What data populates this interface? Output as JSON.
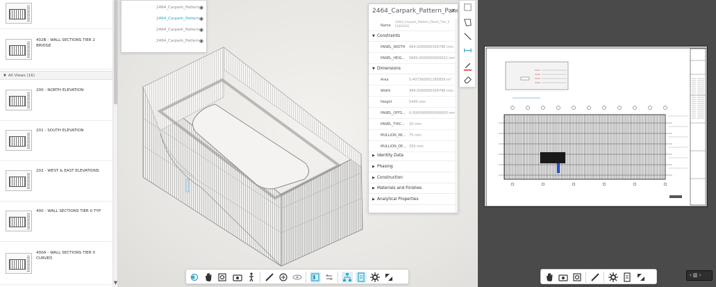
{
  "sheets_panel": {
    "section_header": "All Views (16)",
    "items_top": [
      {
        "label": ""
      },
      {
        "label": "402B - WALL SECTIONS TIER 2 BRIDGE"
      }
    ],
    "items": [
      {
        "label": "200 - NORTH ELEVATION"
      },
      {
        "label": "201 - SOUTH ELEVATION"
      },
      {
        "label": "202 - WEST & EAST ELEVATIONS"
      },
      {
        "label": "400 - WALL SECTIONS TIER 0 TYP"
      },
      {
        "label": "400A - WALL SECTIONS TIER 0 CURVED"
      }
    ]
  },
  "model_browser": {
    "rows": [
      {
        "label": "2464_Carpark_Pattern",
        "active": false
      },
      {
        "label": "2464_Carpark_Pattern",
        "active": true
      },
      {
        "label": "2464_Carpark_Pattern",
        "active": false
      },
      {
        "label": "2464_Carpark_Pattern",
        "active": false
      }
    ]
  },
  "properties": {
    "title": "2464_Carpark_Pattern_Panel",
    "name_key": "Name",
    "name_value": "2464_Carpark_Pattern_Panel_Tier_1 [349102]",
    "sections": {
      "constraints": "Constraints",
      "dimensions": "Dimensions",
      "identity": "Identity Data",
      "phasing": "Phasing",
      "construction": "Construction",
      "materials": "Materials and Finishes",
      "analytical": "Analytical Properties"
    },
    "constraints_rows": [
      {
        "k": "PANEL_WIDTH",
        "v": "994.0000000304796 mm"
      },
      {
        "k": "PANEL_HEIG...",
        "v": "5680.0000000000022 mm"
      }
    ],
    "dimension_rows": [
      {
        "k": "Area",
        "v": "5.407360001165859 m²"
      },
      {
        "k": "Width",
        "v": "994.0000000304796 mm"
      },
      {
        "k": "Height",
        "v": "5440 mm"
      },
      {
        "k": "PANEL_OFFS...",
        "v": "0.0000000000000000 mm"
      },
      {
        "k": "PANEL_THIC...",
        "v": "10 mm"
      },
      {
        "k": "MULLION_WI...",
        "v": "75 mm"
      },
      {
        "k": "MULLION_DE...",
        "v": "250 mm"
      }
    ]
  },
  "sheet_viewer": {
    "pager_label": "‹ ▥ ›"
  },
  "colors": {
    "accent": "#2aa3c9",
    "viewer_bg": "#4a4a4a"
  }
}
